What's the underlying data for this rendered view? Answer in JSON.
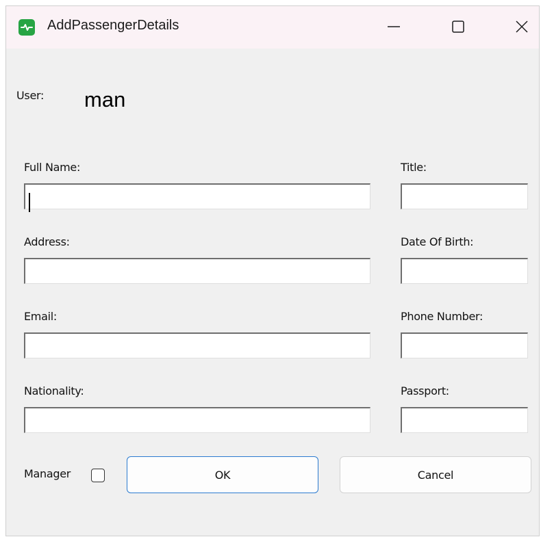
{
  "window": {
    "title": "AddPassengerDetails"
  },
  "titlebar_buttons": [
    "minimize",
    "maximize",
    "close"
  ],
  "user": {
    "label": "User:",
    "value": "man"
  },
  "form": {
    "full_name": {
      "label": "Full Name:",
      "value": ""
    },
    "title": {
      "label": "Title:",
      "value": ""
    },
    "address": {
      "label": "Address:",
      "value": ""
    },
    "date_of_birth": {
      "label": "Date Of Birth:",
      "value": ""
    },
    "email": {
      "label": "Email:",
      "value": ""
    },
    "phone_number": {
      "label": "Phone Number:",
      "value": ""
    },
    "nationality": {
      "label": "Nationality:",
      "value": ""
    },
    "passport": {
      "label": "Passport:",
      "value": ""
    }
  },
  "manager": {
    "label": "Manager",
    "checked": false
  },
  "buttons": {
    "ok": "OK",
    "cancel": "Cancel"
  },
  "colors": {
    "app_icon": "#27a444",
    "ok_border": "#2a7ad0",
    "titlebar": "#fbf2f6",
    "window_bg": "#f0f0f0"
  }
}
